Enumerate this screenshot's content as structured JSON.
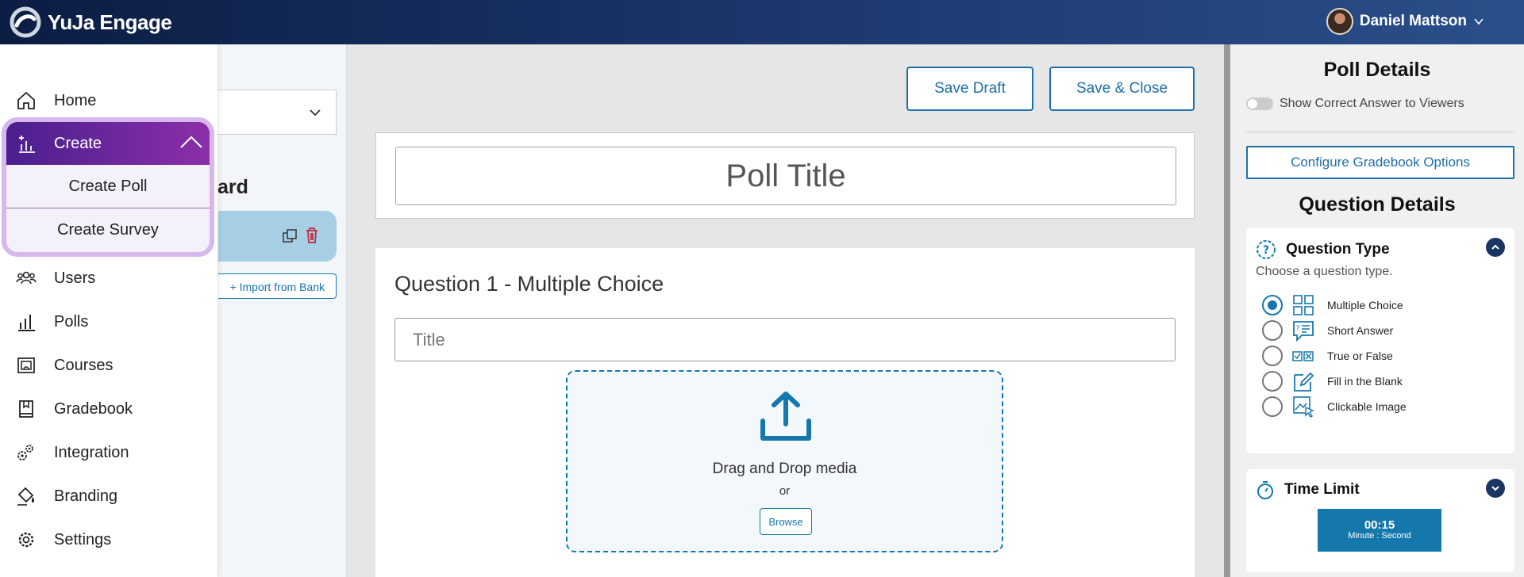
{
  "app": {
    "name": "YuJa Engage"
  },
  "user": {
    "name": "Daniel Mattson"
  },
  "nav": {
    "home": "Home",
    "create": "Create",
    "create_poll": "Create Poll",
    "create_survey": "Create Survey",
    "users": "Users",
    "polls": "Polls",
    "courses": "Courses",
    "gradebook": "Gradebook",
    "integration": "Integration",
    "branding": "Branding",
    "settings": "Settings"
  },
  "list_panel": {
    "board_partial": "ard",
    "import_label": "+ Import from Bank"
  },
  "toolbar": {
    "save_draft": "Save Draft",
    "save_close": "Save & Close"
  },
  "editor": {
    "poll_title_placeholder": "Poll Title",
    "question_heading": "Question 1 - Multiple Choice",
    "question_title_placeholder": "Title",
    "drop_text": "Drag and Drop media",
    "or_text": "or",
    "browse_label": "Browse"
  },
  "details": {
    "poll_details_title": "Poll Details",
    "show_correct_label": "Show Correct Answer to Viewers",
    "show_correct_on": false,
    "configure_gradebook": "Configure Gradebook Options",
    "question_details_title": "Question Details",
    "question_type_heading": "Question Type",
    "question_type_sub": "Choose a question type.",
    "question_types": [
      "Multiple Choice",
      "Short Answer",
      "True or False",
      "Fill in the Blank",
      "Clickable Image"
    ],
    "selected_type": "Multiple Choice",
    "time_limit_heading": "Time Limit",
    "time_value": "00:15",
    "time_unit_label": "Minute : Second"
  },
  "colors": {
    "accent": "#1478ad",
    "create_gradient_start": "#4a1f8e",
    "create_gradient_end": "#8b2fa8",
    "highlight_border": "#d6b8ec",
    "topbar": "#0b1d43"
  }
}
